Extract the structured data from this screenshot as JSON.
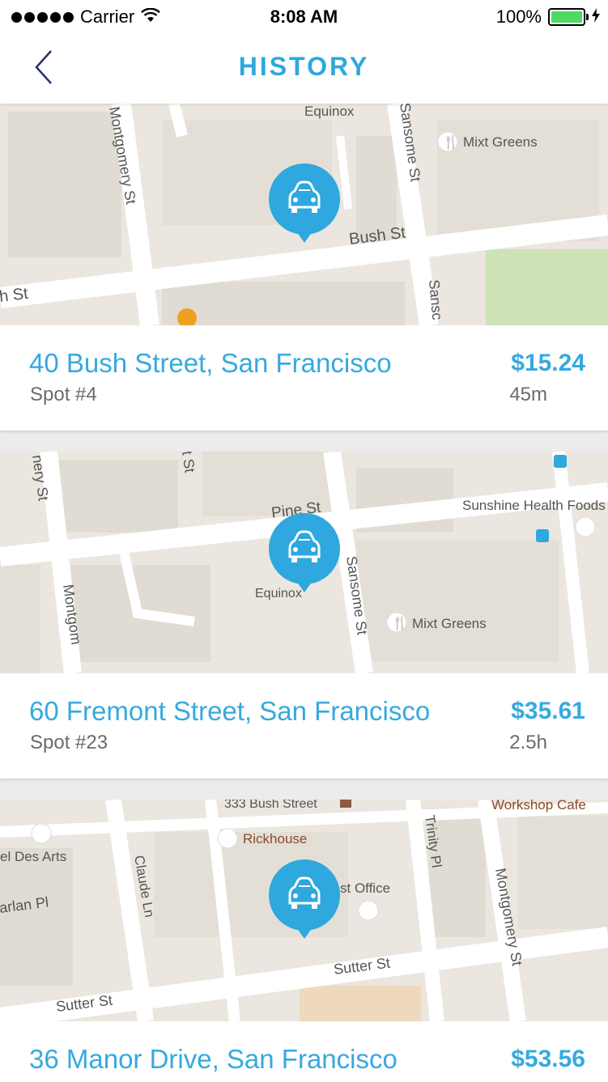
{
  "status_bar": {
    "carrier": "Carrier",
    "time": "8:08 AM",
    "battery": "100%"
  },
  "nav": {
    "title": "HISTORY"
  },
  "history": [
    {
      "address": "40 Bush Street, San Francisco",
      "spot": "Spot #4",
      "price": "$15.24",
      "duration": "45m",
      "map_labels": {
        "a": "Equinox",
        "b": "Montgomery St",
        "c": "Sansome St",
        "d": "Mixt Greens",
        "e": "Bush St",
        "f": "h St",
        "g": "Sansc"
      }
    },
    {
      "address": "60 Fremont Street, San Francisco",
      "spot": "Spot #23",
      "price": "$35.61",
      "duration": "2.5h",
      "map_labels": {
        "a": "nery St",
        "b": "Pine St",
        "c": "Sunshine Health Foods",
        "d": "Equinox",
        "e": "Sansome St",
        "f": "Mixt Greens",
        "g": "Montgom",
        "h": "t St"
      }
    },
    {
      "address": "36 Manor Drive, San Francisco",
      "spot": "",
      "price": "$53.56",
      "duration": "",
      "map_labels": {
        "a": "333 Bush Street",
        "b": "Workshop Cafe",
        "c": "el Des Arts",
        "d": "Rickhouse",
        "e": "Claude Ln",
        "f": "Trinity Pl",
        "g": "Montgomery St",
        "h": "arlan Pl",
        "i": "st Office",
        "j": "Sutter St",
        "k": "Sutter St"
      }
    }
  ],
  "colors": {
    "accent": "#36a9df",
    "pin": "#2ea8de",
    "map_bg": "#ebe6df",
    "road": "#ffffff",
    "park": "#cfe3b6"
  }
}
